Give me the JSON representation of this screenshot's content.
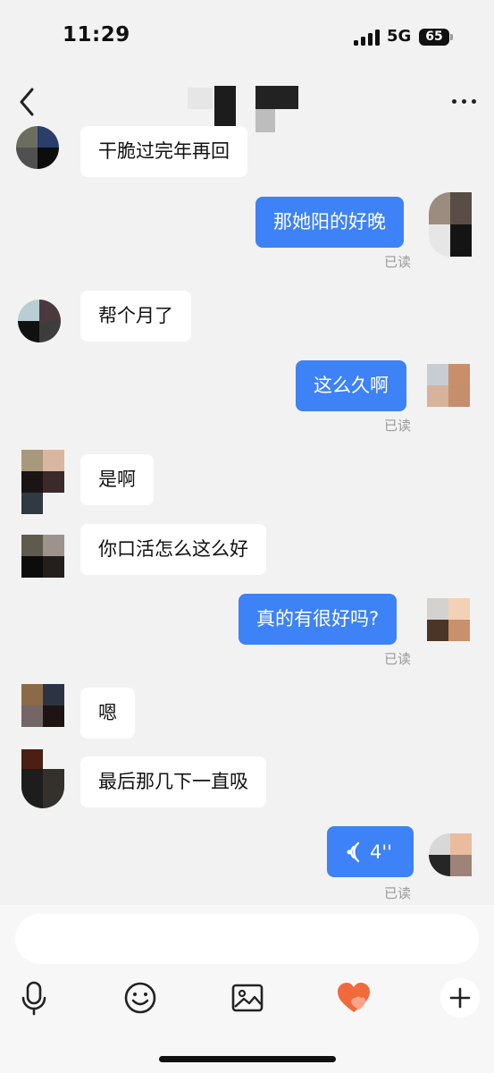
{
  "status_bar": {
    "time": "11:29",
    "network": "5G",
    "battery": "65"
  },
  "messages": [
    {
      "side": "in",
      "text": "干脆过完年再回"
    },
    {
      "side": "out",
      "text": "那她阳的好晚",
      "read": "已读"
    },
    {
      "side": "in",
      "text": "帮个月了"
    },
    {
      "side": "out",
      "text": "这么久啊",
      "read": "已读"
    },
    {
      "side": "in",
      "text": "是啊"
    },
    {
      "side": "in",
      "text": "你口活怎么这么好"
    },
    {
      "side": "out",
      "text": "真的有很好吗?",
      "read": "已读"
    },
    {
      "side": "in",
      "text": "嗯"
    },
    {
      "side": "in",
      "text": "最后那几下一直吸"
    },
    {
      "side": "out",
      "type": "voice",
      "duration": "4''",
      "read": "已读"
    }
  ],
  "input": {
    "value": "",
    "placeholder": ""
  },
  "toolbar": [
    "microphone-icon",
    "emoji-icon",
    "image-icon",
    "heart-icon",
    "plus-icon"
  ],
  "colors": {
    "outgoing_bubble": "#3d82f6",
    "incoming_bubble": "#ffffff",
    "background": "#f2f2f2",
    "read_text": "#9a9a9a",
    "heart": "#f06a3c"
  }
}
